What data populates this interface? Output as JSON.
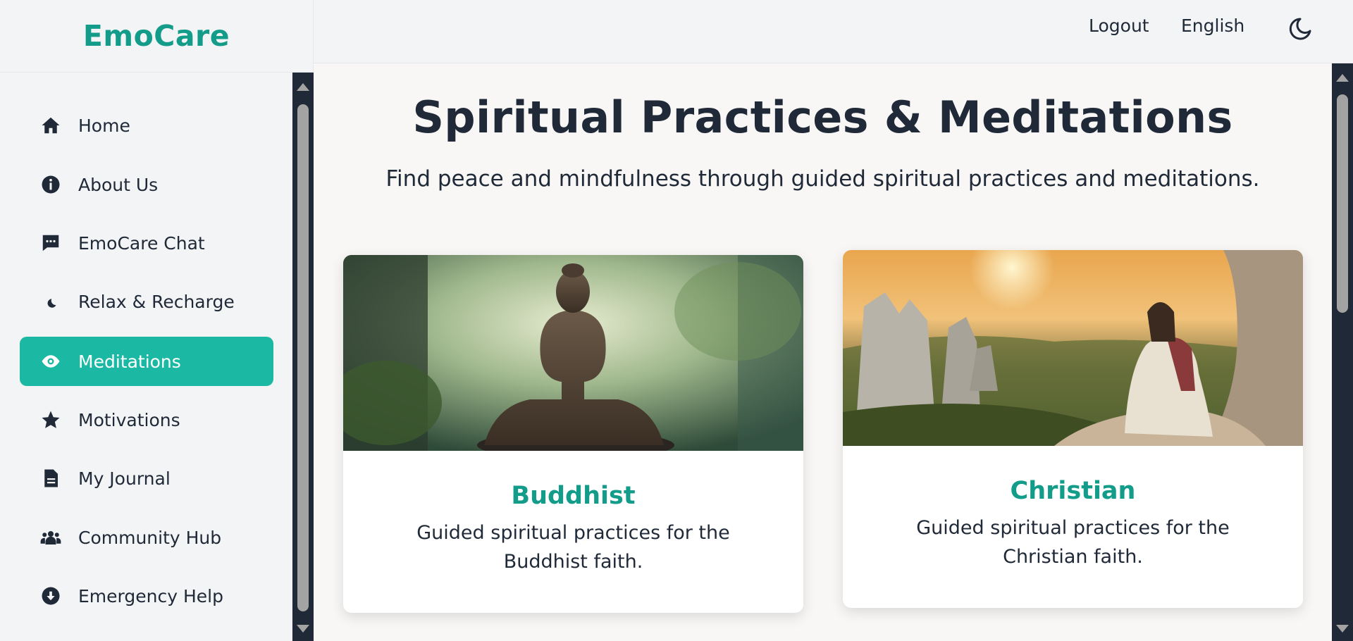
{
  "app": {
    "brand": "EmoCare"
  },
  "sidebar": {
    "items": [
      {
        "label": "Home",
        "icon": "home-icon"
      },
      {
        "label": "About Us",
        "icon": "info-icon"
      },
      {
        "label": "EmoCare Chat",
        "icon": "chat-icon"
      },
      {
        "label": "Relax & Recharge",
        "icon": "moon-icon"
      },
      {
        "label": "Meditations",
        "icon": "eye-icon",
        "active": true
      },
      {
        "label": "Motivations",
        "icon": "star-icon"
      },
      {
        "label": "My Journal",
        "icon": "journal-icon"
      },
      {
        "label": "Community Hub",
        "icon": "users-icon"
      },
      {
        "label": "Emergency Help",
        "icon": "download-circle-icon"
      }
    ]
  },
  "header": {
    "logout": "Logout",
    "language": "English",
    "theme_icon": "moon-icon"
  },
  "main": {
    "title": "Spiritual Practices & Meditations",
    "subtitle": "Find peace and mindfulness through guided spiritual practices and meditations.",
    "cards": [
      {
        "title": "Buddhist",
        "description": "Guided spiritual practices for the Buddhist faith."
      },
      {
        "title": "Christian",
        "description": "Guided spiritual practices for the Christian faith."
      }
    ]
  },
  "colors": {
    "accent": "#1bb9a3",
    "brand_text": "#139c8a",
    "scrollbar": "#1f2937"
  }
}
